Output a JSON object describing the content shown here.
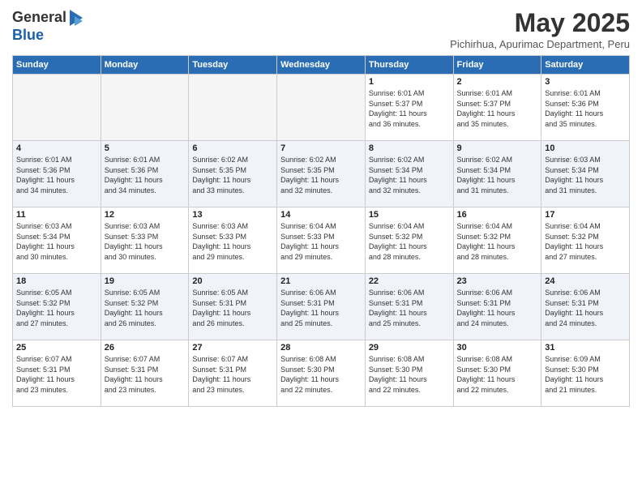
{
  "logo": {
    "general": "General",
    "blue": "Blue"
  },
  "header": {
    "month": "May 2025",
    "location": "Pichirhua, Apurimac Department, Peru"
  },
  "weekdays": [
    "Sunday",
    "Monday",
    "Tuesday",
    "Wednesday",
    "Thursday",
    "Friday",
    "Saturday"
  ],
  "weeks": [
    [
      {
        "day": "",
        "info": ""
      },
      {
        "day": "",
        "info": ""
      },
      {
        "day": "",
        "info": ""
      },
      {
        "day": "",
        "info": ""
      },
      {
        "day": "1",
        "info": "Sunrise: 6:01 AM\nSunset: 5:37 PM\nDaylight: 11 hours\nand 36 minutes."
      },
      {
        "day": "2",
        "info": "Sunrise: 6:01 AM\nSunset: 5:37 PM\nDaylight: 11 hours\nand 35 minutes."
      },
      {
        "day": "3",
        "info": "Sunrise: 6:01 AM\nSunset: 5:36 PM\nDaylight: 11 hours\nand 35 minutes."
      }
    ],
    [
      {
        "day": "4",
        "info": "Sunrise: 6:01 AM\nSunset: 5:36 PM\nDaylight: 11 hours\nand 34 minutes."
      },
      {
        "day": "5",
        "info": "Sunrise: 6:01 AM\nSunset: 5:36 PM\nDaylight: 11 hours\nand 34 minutes."
      },
      {
        "day": "6",
        "info": "Sunrise: 6:02 AM\nSunset: 5:35 PM\nDaylight: 11 hours\nand 33 minutes."
      },
      {
        "day": "7",
        "info": "Sunrise: 6:02 AM\nSunset: 5:35 PM\nDaylight: 11 hours\nand 32 minutes."
      },
      {
        "day": "8",
        "info": "Sunrise: 6:02 AM\nSunset: 5:34 PM\nDaylight: 11 hours\nand 32 minutes."
      },
      {
        "day": "9",
        "info": "Sunrise: 6:02 AM\nSunset: 5:34 PM\nDaylight: 11 hours\nand 31 minutes."
      },
      {
        "day": "10",
        "info": "Sunrise: 6:03 AM\nSunset: 5:34 PM\nDaylight: 11 hours\nand 31 minutes."
      }
    ],
    [
      {
        "day": "11",
        "info": "Sunrise: 6:03 AM\nSunset: 5:34 PM\nDaylight: 11 hours\nand 30 minutes."
      },
      {
        "day": "12",
        "info": "Sunrise: 6:03 AM\nSunset: 5:33 PM\nDaylight: 11 hours\nand 30 minutes."
      },
      {
        "day": "13",
        "info": "Sunrise: 6:03 AM\nSunset: 5:33 PM\nDaylight: 11 hours\nand 29 minutes."
      },
      {
        "day": "14",
        "info": "Sunrise: 6:04 AM\nSunset: 5:33 PM\nDaylight: 11 hours\nand 29 minutes."
      },
      {
        "day": "15",
        "info": "Sunrise: 6:04 AM\nSunset: 5:32 PM\nDaylight: 11 hours\nand 28 minutes."
      },
      {
        "day": "16",
        "info": "Sunrise: 6:04 AM\nSunset: 5:32 PM\nDaylight: 11 hours\nand 28 minutes."
      },
      {
        "day": "17",
        "info": "Sunrise: 6:04 AM\nSunset: 5:32 PM\nDaylight: 11 hours\nand 27 minutes."
      }
    ],
    [
      {
        "day": "18",
        "info": "Sunrise: 6:05 AM\nSunset: 5:32 PM\nDaylight: 11 hours\nand 27 minutes."
      },
      {
        "day": "19",
        "info": "Sunrise: 6:05 AM\nSunset: 5:32 PM\nDaylight: 11 hours\nand 26 minutes."
      },
      {
        "day": "20",
        "info": "Sunrise: 6:05 AM\nSunset: 5:31 PM\nDaylight: 11 hours\nand 26 minutes."
      },
      {
        "day": "21",
        "info": "Sunrise: 6:06 AM\nSunset: 5:31 PM\nDaylight: 11 hours\nand 25 minutes."
      },
      {
        "day": "22",
        "info": "Sunrise: 6:06 AM\nSunset: 5:31 PM\nDaylight: 11 hours\nand 25 minutes."
      },
      {
        "day": "23",
        "info": "Sunrise: 6:06 AM\nSunset: 5:31 PM\nDaylight: 11 hours\nand 24 minutes."
      },
      {
        "day": "24",
        "info": "Sunrise: 6:06 AM\nSunset: 5:31 PM\nDaylight: 11 hours\nand 24 minutes."
      }
    ],
    [
      {
        "day": "25",
        "info": "Sunrise: 6:07 AM\nSunset: 5:31 PM\nDaylight: 11 hours\nand 23 minutes."
      },
      {
        "day": "26",
        "info": "Sunrise: 6:07 AM\nSunset: 5:31 PM\nDaylight: 11 hours\nand 23 minutes."
      },
      {
        "day": "27",
        "info": "Sunrise: 6:07 AM\nSunset: 5:31 PM\nDaylight: 11 hours\nand 23 minutes."
      },
      {
        "day": "28",
        "info": "Sunrise: 6:08 AM\nSunset: 5:30 PM\nDaylight: 11 hours\nand 22 minutes."
      },
      {
        "day": "29",
        "info": "Sunrise: 6:08 AM\nSunset: 5:30 PM\nDaylight: 11 hours\nand 22 minutes."
      },
      {
        "day": "30",
        "info": "Sunrise: 6:08 AM\nSunset: 5:30 PM\nDaylight: 11 hours\nand 22 minutes."
      },
      {
        "day": "31",
        "info": "Sunrise: 6:09 AM\nSunset: 5:30 PM\nDaylight: 11 hours\nand 21 minutes."
      }
    ]
  ]
}
